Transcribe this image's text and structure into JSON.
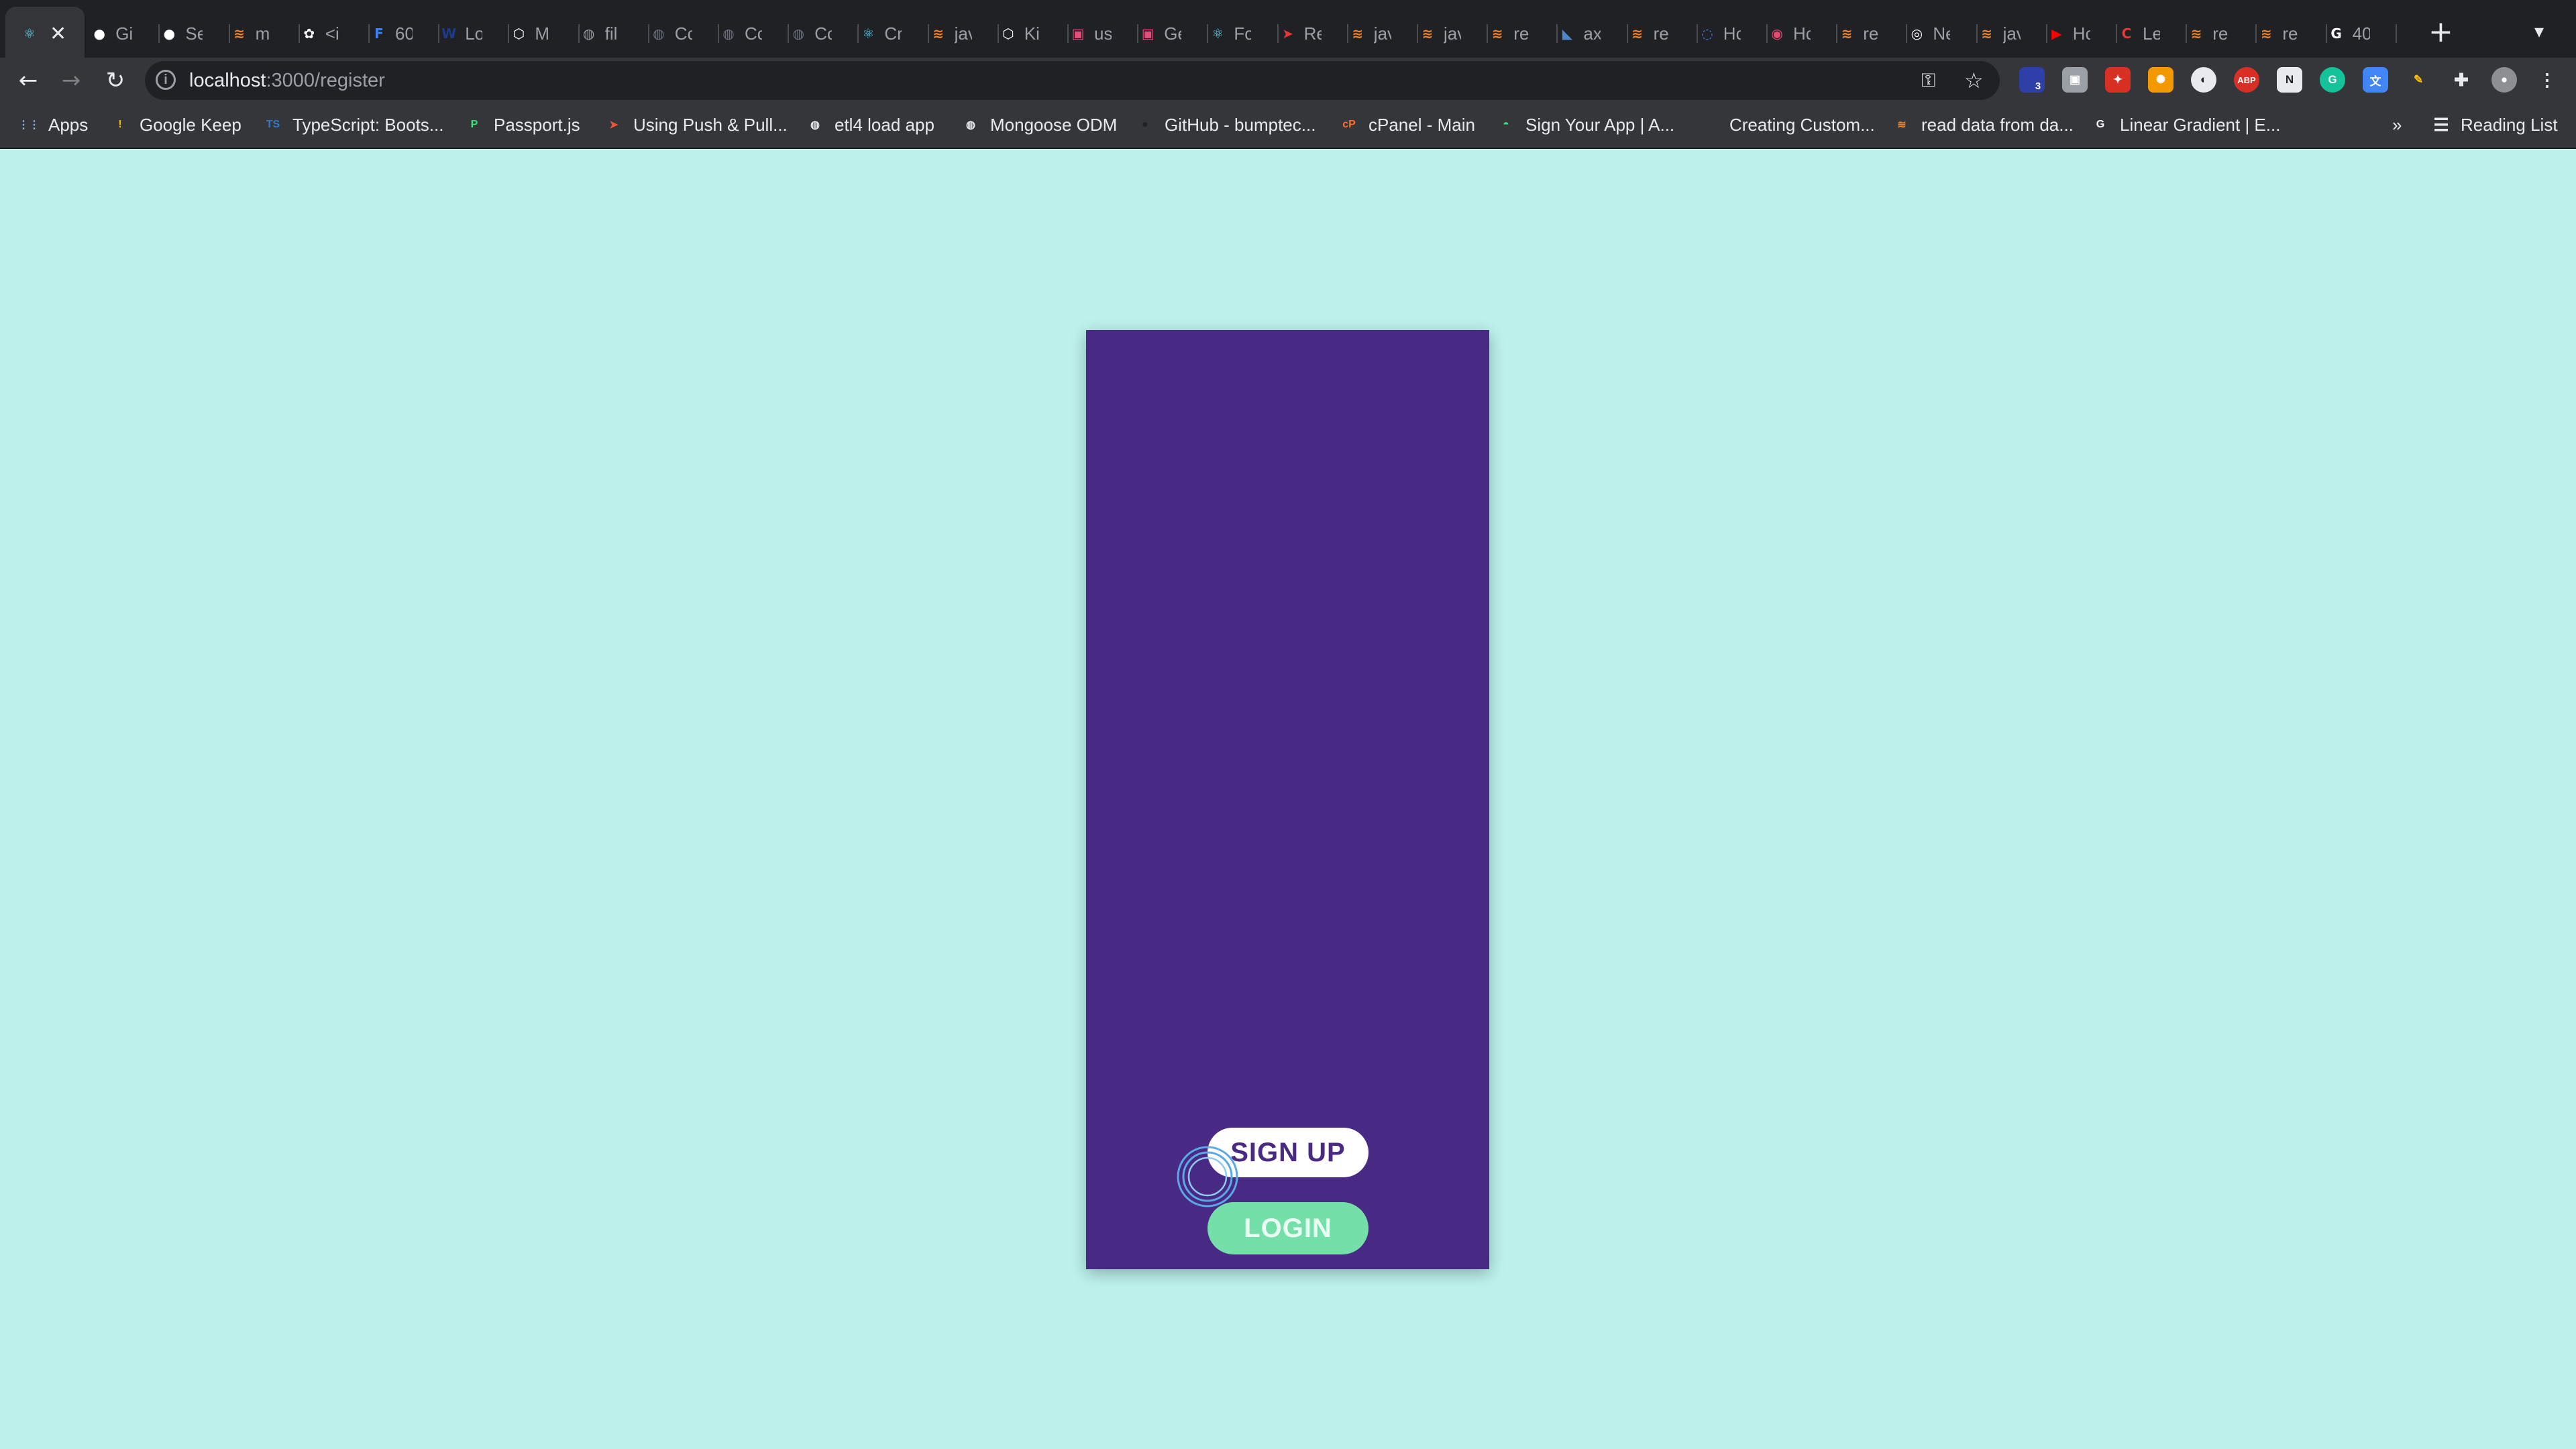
{
  "browser": {
    "tabs": [
      {
        "title": "",
        "icon": "react-icon",
        "active": true,
        "color": "#61dafb"
      },
      {
        "title": "Gi",
        "icon": "github-icon",
        "color": "#ffffff"
      },
      {
        "title": "Se",
        "icon": "github-icon",
        "color": "#ffffff"
      },
      {
        "title": "m",
        "icon": "stackoverflow-icon",
        "color": "#f48024"
      },
      {
        "title": "<i",
        "icon": "paw-icon",
        "color": "#ffffff"
      },
      {
        "title": "60",
        "icon": "fcc-icon",
        "color": "#3b82f6"
      },
      {
        "title": "Lo",
        "icon": "w3schools-icon",
        "color": "#1e3a8a"
      },
      {
        "title": "M",
        "icon": "codepen-icon",
        "color": "#ffffff"
      },
      {
        "title": "fil",
        "icon": "globe-icon",
        "color": "#9aa0a6"
      },
      {
        "title": "Cc",
        "icon": "globe-icon",
        "color": "#6b7280"
      },
      {
        "title": "Cc",
        "icon": "globe-icon",
        "color": "#6b7280"
      },
      {
        "title": "Cc",
        "icon": "globe-icon",
        "color": "#6b7280"
      },
      {
        "title": "Cr",
        "icon": "react-icon",
        "color": "#61dafb"
      },
      {
        "title": "jav",
        "icon": "stackoverflow-icon",
        "color": "#f48024"
      },
      {
        "title": "Ki",
        "icon": "codepen-icon",
        "color": "#ffffff"
      },
      {
        "title": "us",
        "icon": "pink-square-icon",
        "color": "#e84d7e"
      },
      {
        "title": "Ge",
        "icon": "pink-square-icon",
        "color": "#e84d7e"
      },
      {
        "title": "Fo",
        "icon": "react-icon",
        "color": "#61dafb"
      },
      {
        "title": "Re",
        "icon": "red-arrow-icon",
        "color": "#e53935"
      },
      {
        "title": "jav",
        "icon": "stackoverflow-icon",
        "color": "#f48024"
      },
      {
        "title": "jav",
        "icon": "stackoverflow-icon",
        "color": "#f48024"
      },
      {
        "title": "re",
        "icon": "stackoverflow-icon",
        "color": "#f48024"
      },
      {
        "title": "ax",
        "icon": "mongoose-icon",
        "color": "#4f86c6"
      },
      {
        "title": "re",
        "icon": "stackoverflow-icon",
        "color": "#f48024"
      },
      {
        "title": "Hc",
        "icon": "heroku-icon",
        "color": "#3b82f6"
      },
      {
        "title": "Hc",
        "icon": "record-icon",
        "color": "#e74c6f"
      },
      {
        "title": "re",
        "icon": "stackoverflow-icon",
        "color": "#f48024"
      },
      {
        "title": "Ne",
        "icon": "chrome-icon",
        "color": "#ffffff"
      },
      {
        "title": "jav",
        "icon": "stackoverflow-icon",
        "color": "#f48024"
      },
      {
        "title": "Hc",
        "icon": "youtube-icon",
        "color": "#ff0000"
      },
      {
        "title": "Le",
        "icon": "c-icon",
        "color": "#e53935"
      },
      {
        "title": "re",
        "icon": "stackoverflow-icon",
        "color": "#f48024"
      },
      {
        "title": "re",
        "icon": "stackoverflow-icon",
        "color": "#f48024"
      },
      {
        "title": "40",
        "icon": "google-icon",
        "color": "#ffffff"
      }
    ],
    "url_host": "localhost",
    "url_path": ":3000/register",
    "bookmarks": [
      {
        "label": "Apps",
        "icon": "apps-grid-icon",
        "color": "#8ab4f8"
      },
      {
        "label": "Google Keep",
        "icon": "keep-icon",
        "color": "#fbbc04"
      },
      {
        "label": "TypeScript: Boots...",
        "icon": "typescript-icon",
        "color": "#3178c6"
      },
      {
        "label": "Passport.js",
        "icon": "passport-icon",
        "color": "#34e27a"
      },
      {
        "label": "Using Push & Pull...",
        "icon": "bookmark-arrow-icon",
        "color": "#e8573c"
      },
      {
        "label": "etl4 load app",
        "icon": "globe-icon",
        "color": "#e8eaed"
      },
      {
        "label": "Mongoose ODM",
        "icon": "globe-icon",
        "color": "#e8eaed"
      },
      {
        "label": "GitHub - bumptec...",
        "icon": "github-icon",
        "color": "#202124"
      },
      {
        "label": "cPanel - Main",
        "icon": "cpanel-icon",
        "color": "#ff6c2c"
      },
      {
        "label": "Sign Your App | A...",
        "icon": "android-icon",
        "color": "#3ddc84"
      },
      {
        "label": "Creating Custom...",
        "icon": "blank-page-icon",
        "color": "#35363a"
      },
      {
        "label": "read data from da...",
        "icon": "stackoverflow-icon",
        "color": "#f48024"
      },
      {
        "label": "Linear Gradient | E...",
        "icon": "google-icon",
        "color": "#ffffff"
      }
    ],
    "overflow_label": "»",
    "reading_list_label": "Reading List",
    "extension_badge_count": "3"
  },
  "page": {
    "background_color": "#bdf1ec",
    "panel_color": "#482a84",
    "signup_label": "SIGN UP",
    "login_label": "LOGIN",
    "login_color": "#74dfa9"
  }
}
